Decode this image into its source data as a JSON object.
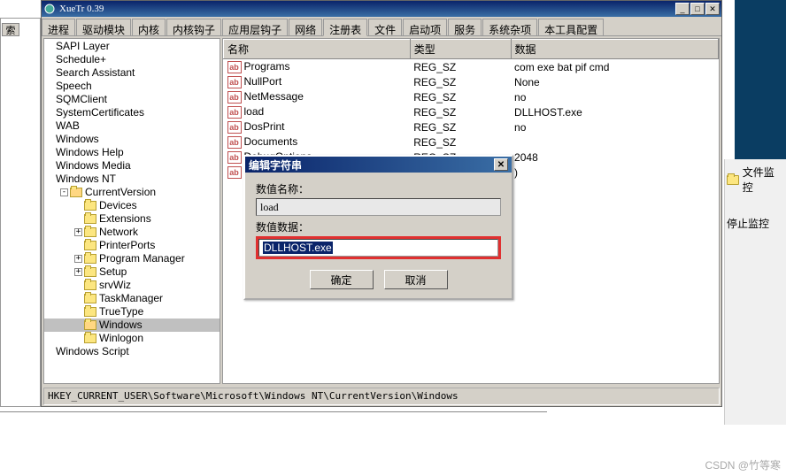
{
  "title": "XueTr 0.39",
  "left_label": "索",
  "right": {
    "file_mon": "文件监控",
    "stop_mon": "停止监控"
  },
  "tabs": [
    "进程",
    "驱动模块",
    "内核",
    "内核钩子",
    "应用层钩子",
    "网络",
    "注册表",
    "文件",
    "启动项",
    "服务",
    "系统杂项",
    "本工具配置"
  ],
  "active_tab": 6,
  "tree": [
    {
      "d": 0,
      "t": "",
      "n": "SAPI Layer"
    },
    {
      "d": 0,
      "t": "",
      "n": "Schedule+"
    },
    {
      "d": 0,
      "t": "",
      "n": "Search Assistant"
    },
    {
      "d": 0,
      "t": "",
      "n": "Speech"
    },
    {
      "d": 0,
      "t": "",
      "n": "SQMClient"
    },
    {
      "d": 0,
      "t": "",
      "n": "SystemCertificates"
    },
    {
      "d": 0,
      "t": "",
      "n": "WAB"
    },
    {
      "d": 0,
      "t": "",
      "n": "Windows"
    },
    {
      "d": 0,
      "t": "",
      "n": "Windows Help"
    },
    {
      "d": 0,
      "t": "",
      "n": "Windows Media"
    },
    {
      "d": 0,
      "t": "",
      "n": "Windows NT"
    },
    {
      "d": 1,
      "t": "-",
      "n": "CurrentVersion",
      "open": true
    },
    {
      "d": 2,
      "t": "",
      "n": "Devices"
    },
    {
      "d": 2,
      "t": "",
      "n": "Extensions"
    },
    {
      "d": 2,
      "t": "+",
      "n": "Network"
    },
    {
      "d": 2,
      "t": "",
      "n": "PrinterPorts"
    },
    {
      "d": 2,
      "t": "+",
      "n": "Program Manager"
    },
    {
      "d": 2,
      "t": "+",
      "n": "Setup"
    },
    {
      "d": 2,
      "t": "",
      "n": "srvWiz"
    },
    {
      "d": 2,
      "t": "",
      "n": "TaskManager"
    },
    {
      "d": 2,
      "t": "",
      "n": "TrueType"
    },
    {
      "d": 2,
      "t": "",
      "n": "Windows",
      "sel": true,
      "open": true
    },
    {
      "d": 2,
      "t": "",
      "n": "Winlogon"
    },
    {
      "d": 0,
      "t": "",
      "n": "Windows Script"
    }
  ],
  "columns": [
    "名称",
    "类型",
    "数据"
  ],
  "rows": [
    {
      "n": "Programs",
      "t": "REG_SZ",
      "d": "com exe bat pif cmd"
    },
    {
      "n": "NullPort",
      "t": "REG_SZ",
      "d": "None"
    },
    {
      "n": "NetMessage",
      "t": "REG_SZ",
      "d": "no"
    },
    {
      "n": "load",
      "t": "REG_SZ",
      "d": "DLLHOST.exe"
    },
    {
      "n": "DosPrint",
      "t": "REG_SZ",
      "d": "no"
    },
    {
      "n": "Documents",
      "t": "REG_SZ",
      "d": ""
    },
    {
      "n": "DebugOptions",
      "t": "REG_SZ",
      "d": "2048"
    },
    {
      "n": "(",
      "t": "",
      "d": ")",
      "cut": true
    }
  ],
  "status": "HKEY_CURRENT_USER\\Software\\Microsoft\\Windows NT\\CurrentVersion\\Windows",
  "dialog": {
    "title": "编辑字符串",
    "name_label": "数值名称：",
    "name_value": "load",
    "data_label": "数值数据：",
    "data_value": "DLLHOST.exe",
    "ok": "确定",
    "cancel": "取消"
  },
  "watermark": "CSDN @竹等寒"
}
